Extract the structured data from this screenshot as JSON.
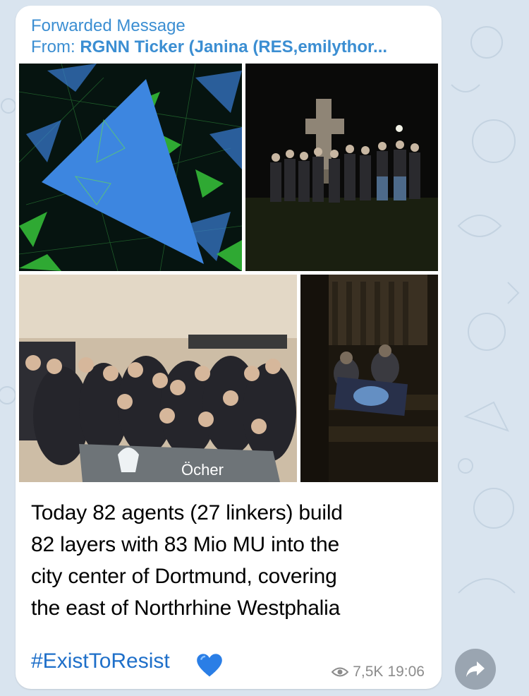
{
  "forward": {
    "header": "Forwarded Message",
    "from_prefix": "From:",
    "from_name": "RGNN Ticker (Janina (RES,emilythor..."
  },
  "media": [
    {
      "name": "ingress-map-field"
    },
    {
      "name": "group-at-stone-cross-night"
    },
    {
      "name": "group-indoor-with-banner",
      "banner_text": "Öcher"
    },
    {
      "name": "two-agents-with-flag-night"
    }
  ],
  "caption": {
    "lines": [
      "Today 82 agents (27 linkers) build",
      "82 layers with 83 Mio MU into the",
      "city center of Dortmund, covering",
      "the east of Northrhine Westphalia"
    ],
    "hashtag": "#ExistToResist",
    "emoji": "blue-heart"
  },
  "meta": {
    "views": "7,5K",
    "time": "19:06"
  },
  "colors": {
    "accent": "#3b8ed2",
    "hashtag": "#1e6fc9",
    "meta": "#8c8c8c",
    "wallpaper": "#d9e4ef",
    "share_button": "#9aa5b1"
  },
  "icons": {
    "views": "eye-icon",
    "share": "share-arrow-icon"
  }
}
